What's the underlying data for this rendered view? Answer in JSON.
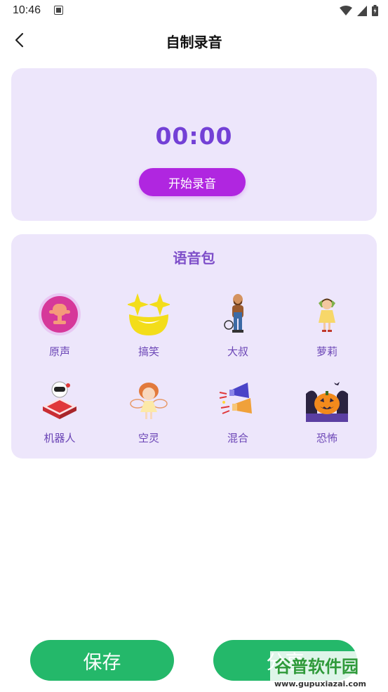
{
  "status_bar": {
    "time": "10:46"
  },
  "app_bar": {
    "title": "自制录音"
  },
  "recorder": {
    "timer": "00:00",
    "record_button": "开始录音"
  },
  "voice_pack": {
    "title": "语音包",
    "items": [
      {
        "label": "原声",
        "icon": "microphone-icon"
      },
      {
        "label": "搞笑",
        "icon": "funny-face-icon"
      },
      {
        "label": "大叔",
        "icon": "uncle-icon"
      },
      {
        "label": "萝莉",
        "icon": "girl-icon"
      },
      {
        "label": "机器人",
        "icon": "robot-icon"
      },
      {
        "label": "空灵",
        "icon": "fairy-icon"
      },
      {
        "label": "混合",
        "icon": "megaphone-icon"
      },
      {
        "label": "恐怖",
        "icon": "pumpkin-icon"
      }
    ]
  },
  "actions": {
    "save": "保存",
    "share": "分享"
  },
  "watermark": {
    "text": "谷普软件园",
    "url": "www.gupuxiazai.com"
  },
  "colors": {
    "accent": "#7340d6",
    "record": "#b026e0",
    "card": "#ede6fb",
    "action": "#24b86a"
  }
}
